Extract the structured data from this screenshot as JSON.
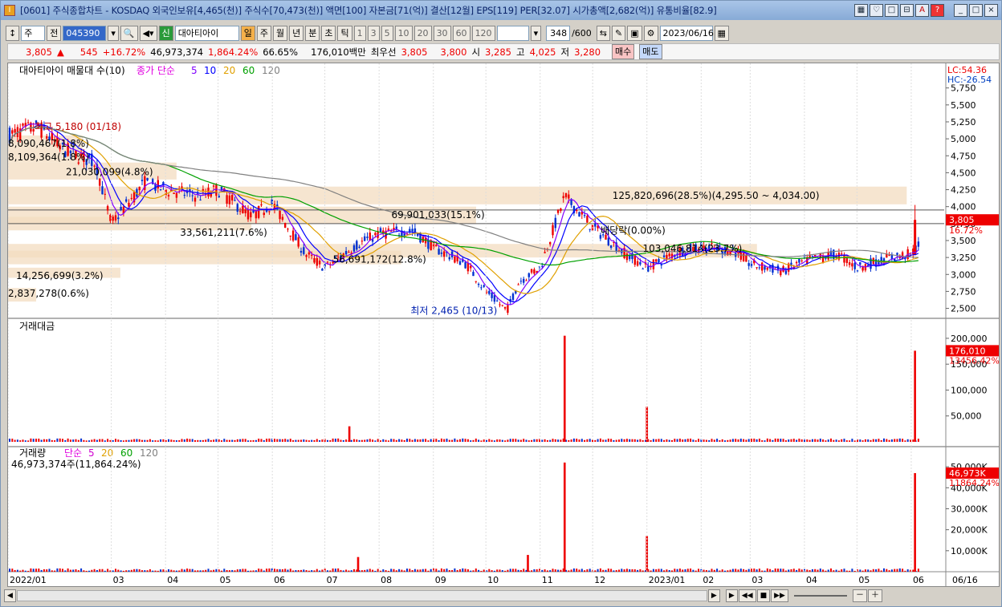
{
  "window": {
    "title": "[0601] 주식종합차트 - KOSDAQ 외국인보유[4,465(천)] 주식수[70,473(천)] 액면[100] 자본금[71(억)] 결산[12월] EPS[119] PER[32.07] 시가총액[2,682(억)] 유통비율[82.9]",
    "buttons": [
      "▦",
      "♡",
      "□",
      "⊟",
      "A",
      "?"
    ],
    "controls": [
      "_",
      "□",
      "×"
    ]
  },
  "toolbar": {
    "type_select": "주",
    "whole_btn": "전",
    "code": "045390",
    "stock_name": "대아티아이",
    "credit": "신",
    "periods": [
      "일",
      "주",
      "월",
      "년",
      "분",
      "초",
      "틱"
    ],
    "selected_period": "일",
    "numbers": [
      "1",
      "3",
      "5",
      "10",
      "20",
      "30",
      "60",
      "120"
    ],
    "count": "348",
    "count_max": "/600",
    "date": "2023/06/16"
  },
  "quote": {
    "price": "3,805",
    "change_arrow": "▲",
    "change": "545",
    "change_pct": "+16.72%",
    "volume": "46,973,374",
    "volume_pct": "1,864.24%",
    "turnover": "66.65%",
    "amount": "176,010백만",
    "best_label": "최우선",
    "ask": "3,805",
    "bid": "3,800",
    "open_label": "시",
    "open": "3,285",
    "high_label": "고",
    "high": "4,025",
    "low_label": "저",
    "low": "3,280",
    "buy": "매수",
    "sell": "매도"
  },
  "price_panel": {
    "title": "대아티아이 매물대 수(10)",
    "ma_label": "종가 단순",
    "ma_periods": [
      {
        "p": "5",
        "color": "#8000ff"
      },
      {
        "p": "10",
        "color": "#0000ff"
      },
      {
        "p": "20",
        "color": "#e0a000"
      },
      {
        "p": "60",
        "color": "#00a000"
      },
      {
        "p": "120",
        "color": "#808080"
      }
    ],
    "lc": "LC:54.36",
    "hc": "HC:-26.54",
    "y_ticks": [
      "5,750",
      "5,500",
      "5,250",
      "5,000",
      "4,750",
      "4,500",
      "4,250",
      "4,000",
      "3,750",
      "3,500",
      "3,250",
      "3,000",
      "2,750",
      "2,500"
    ],
    "last_price": "3,805",
    "last_pct": "16.72%",
    "annotations": {
      "high": "최고 5,180 (01/18)",
      "low": "최저 2,465 (10/13)",
      "dividend": "배당락(0.00%)"
    },
    "volume_profile": [
      "125,820,696(28.5%)(4,295.50 ~ 4,034.00)",
      "69,901,033(15.1%)",
      "33,561,211(7.6%)",
      "56,691,172(12.8%)",
      "14,256,699(3.2%)",
      "2,837,278(0.6%)",
      "21,030,099(4.8%)",
      "8,109,364(1.8%)",
      "8,090,467(1.8%)",
      "103,046,814(23.7%)"
    ]
  },
  "amount_panel": {
    "title": "거래대금",
    "y_ticks": [
      "200,000",
      "150,000",
      "100,000",
      "50,000"
    ],
    "last": "176,010",
    "last2": "13456.42%"
  },
  "volume_panel": {
    "title": "거래량",
    "ma_label": "단순",
    "ma_periods": [
      {
        "p": "5",
        "color": "#d000d0"
      },
      {
        "p": "20",
        "color": "#e0a000"
      },
      {
        "p": "60",
        "color": "#00a000"
      },
      {
        "p": "120",
        "color": "#808080"
      }
    ],
    "info": "46,973,374주(11,864.24%)",
    "y_ticks": [
      "50,000K",
      "40,000K",
      "30,000K",
      "20,000K",
      "10,000K"
    ],
    "last": "46,973K",
    "last2": "11864.24%"
  },
  "x_axis": [
    "2022/01",
    "03",
    "04",
    "05",
    "06",
    "07",
    "08",
    "09",
    "10",
    "11",
    "12",
    "2023/01",
    "02",
    "03",
    "04",
    "05",
    "06",
    "06/16"
  ],
  "chart_data": {
    "type": "candlestick",
    "title": "대아티아이 매물대 수(10)",
    "x_range": [
      "2022/01",
      "2023/06/16"
    ],
    "price_ylim": [
      2400,
      5900
    ],
    "high": {
      "value": 5180,
      "date": "01/18"
    },
    "low": {
      "value": 2465,
      "date": "10/13"
    },
    "last_close": 3805,
    "close_path": [
      {
        "x": "2022/01",
        "y": 5050
      },
      {
        "x": "2022/01/18",
        "y": 5180
      },
      {
        "x": "2022/02",
        "y": 4850
      },
      {
        "x": "2022/02/20",
        "y": 4650
      },
      {
        "x": "2022/03",
        "y": 3750
      },
      {
        "x": "2022/03/20",
        "y": 4350
      },
      {
        "x": "2022/04",
        "y": 4250
      },
      {
        "x": "2022/04/20",
        "y": 4150
      },
      {
        "x": "2022/05",
        "y": 4250
      },
      {
        "x": "2022/05/20",
        "y": 3850
      },
      {
        "x": "2022/06",
        "y": 4050
      },
      {
        "x": "2022/06/20",
        "y": 3300
      },
      {
        "x": "2022/07",
        "y": 3100
      },
      {
        "x": "2022/07/20",
        "y": 3450
      },
      {
        "x": "2022/08",
        "y": 3600
      },
      {
        "x": "2022/08/20",
        "y": 3650
      },
      {
        "x": "2022/09",
        "y": 3400
      },
      {
        "x": "2022/09/20",
        "y": 3150
      },
      {
        "x": "2022/10",
        "y": 2750
      },
      {
        "x": "2022/10/13",
        "y": 2465
      },
      {
        "x": "2022/10/20",
        "y": 2900
      },
      {
        "x": "2022/11",
        "y": 3100
      },
      {
        "x": "2022/11/15",
        "y": 4150
      },
      {
        "x": "2022/12",
        "y": 3700
      },
      {
        "x": "2022/12/20",
        "y": 3300
      },
      {
        "x": "2023/01",
        "y": 3100
      },
      {
        "x": "2023/01/20",
        "y": 3350
      },
      {
        "x": "2023/02",
        "y": 3400
      },
      {
        "x": "2023/02/20",
        "y": 3350
      },
      {
        "x": "2023/03",
        "y": 3150
      },
      {
        "x": "2023/03/20",
        "y": 3050
      },
      {
        "x": "2023/04",
        "y": 3200
      },
      {
        "x": "2023/04/20",
        "y": 3300
      },
      {
        "x": "2023/05",
        "y": 3100
      },
      {
        "x": "2023/05/20",
        "y": 3250
      },
      {
        "x": "2023/06",
        "y": 3300
      },
      {
        "x": "2023/06/16",
        "y": 3805
      }
    ],
    "volume_spikes_k": [
      {
        "x": "2022/11/15",
        "y": 52000
      },
      {
        "x": "2023/06/16",
        "y": 46973
      },
      {
        "x": "2023/01/01",
        "y": 17000
      },
      {
        "x": "2022/07/20",
        "y": 7000
      },
      {
        "x": "2022/10/25",
        "y": 8000
      }
    ],
    "amount_spikes": [
      {
        "x": "2022/11/15",
        "y": 205000
      },
      {
        "x": "2023/06/16",
        "y": 176010
      },
      {
        "x": "2023/01/01",
        "y": 68000
      },
      {
        "x": "2022/07/15",
        "y": 30000
      }
    ]
  }
}
